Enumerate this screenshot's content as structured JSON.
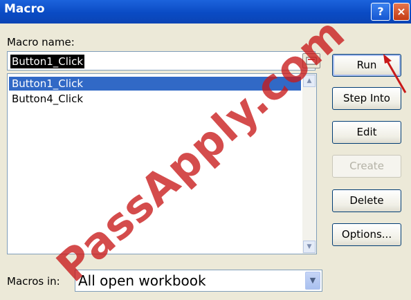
{
  "window": {
    "title": "Macro",
    "help_label": "?",
    "close_label": "×"
  },
  "macro_name": {
    "label": "Macro name:",
    "value": "Button1_Click"
  },
  "macro_list": {
    "items": [
      {
        "label": "Button1_Click",
        "selected": true
      },
      {
        "label": "Button4_Click",
        "selected": false
      }
    ]
  },
  "buttons": {
    "run": "Run",
    "step_into": "Step Into",
    "edit": "Edit",
    "create": "Create",
    "delete": "Delete",
    "options": "Options..."
  },
  "macros_in": {
    "label": "Macros in:",
    "value": "All open workbook"
  },
  "watermark": "PassApply.com",
  "colors": {
    "title_bar": "#0a4bc4",
    "selection": "#3169c6",
    "watermark": "#c81919"
  }
}
